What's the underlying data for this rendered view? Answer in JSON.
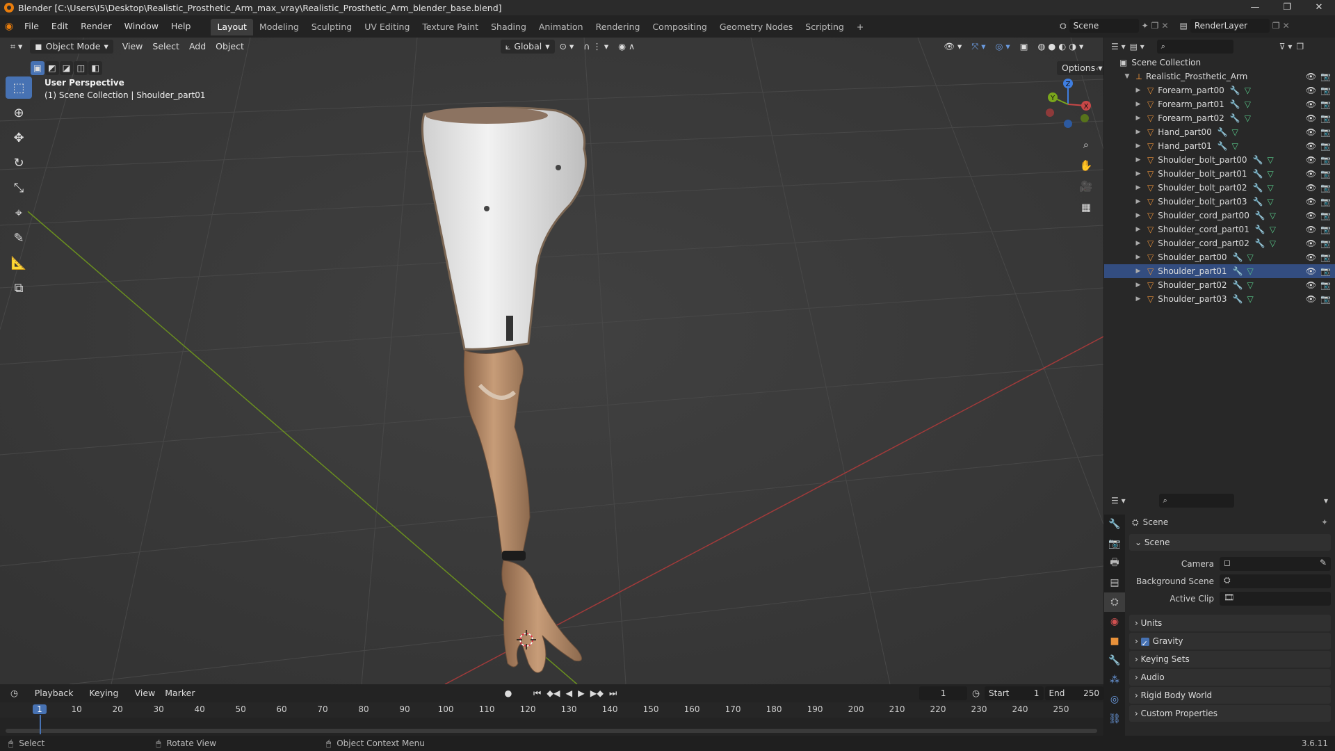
{
  "window": {
    "title": "Blender [C:\\Users\\I5\\Desktop\\Realistic_Prosthetic_Arm_max_vray\\Realistic_Prosthetic_Arm_blender_base.blend]",
    "controls": [
      "—",
      "❐",
      "✕"
    ]
  },
  "menubar": {
    "menus": [
      "File",
      "Edit",
      "Render",
      "Window",
      "Help"
    ],
    "workspaces": [
      "Layout",
      "Modeling",
      "Sculpting",
      "UV Editing",
      "Texture Paint",
      "Shading",
      "Animation",
      "Rendering",
      "Compositing",
      "Geometry Nodes",
      "Scripting"
    ],
    "add_tab": "+",
    "scene": "Scene",
    "view_layer": "RenderLayer"
  },
  "viewport": {
    "mode": "Object Mode",
    "menus": [
      "View",
      "Select",
      "Add",
      "Object"
    ],
    "orientation": "Global",
    "options_label": "Options",
    "overlay_line1": "User Perspective",
    "overlay_line2": "(1) Scene Collection | Shoulder_part01",
    "gizmo_axes": {
      "x": "X",
      "y": "Y",
      "z": "Z"
    }
  },
  "outliner": {
    "root": "Scene Collection",
    "collection": "Realistic_Prosthetic_Arm",
    "objects": [
      {
        "name": "Forearm_part00"
      },
      {
        "name": "Forearm_part01"
      },
      {
        "name": "Forearm_part02"
      },
      {
        "name": "Hand_part00"
      },
      {
        "name": "Hand_part01"
      },
      {
        "name": "Shoulder_bolt_part00"
      },
      {
        "name": "Shoulder_bolt_part01"
      },
      {
        "name": "Shoulder_bolt_part02"
      },
      {
        "name": "Shoulder_bolt_part03"
      },
      {
        "name": "Shoulder_cord_part00"
      },
      {
        "name": "Shoulder_cord_part01"
      },
      {
        "name": "Shoulder_cord_part02"
      },
      {
        "name": "Shoulder_part00"
      },
      {
        "name": "Shoulder_part01"
      },
      {
        "name": "Shoulder_part02"
      },
      {
        "name": "Shoulder_part03"
      }
    ],
    "selected_index": 13
  },
  "properties": {
    "context_title": "Scene",
    "scene_panel": "Scene",
    "fields": [
      {
        "label": "Camera"
      },
      {
        "label": "Background Scene"
      },
      {
        "label": "Active Clip"
      }
    ],
    "panels": [
      "Units",
      "Gravity",
      "Keying Sets",
      "Audio",
      "Rigid Body World",
      "Custom Properties"
    ],
    "gravity_checked": true
  },
  "timeline": {
    "menus": [
      "Playback",
      "Keying",
      "View",
      "Marker"
    ],
    "current_frame": "1",
    "start_label": "Start",
    "start": "1",
    "end_label": "End",
    "end": "250",
    "ticks": [
      "1",
      "10",
      "20",
      "30",
      "40",
      "50",
      "60",
      "70",
      "80",
      "90",
      "100",
      "110",
      "120",
      "130",
      "140",
      "150",
      "160",
      "170",
      "180",
      "190",
      "200",
      "210",
      "220",
      "230",
      "240",
      "250"
    ]
  },
  "statusbar": {
    "items": [
      "Select",
      "Rotate View",
      "Object Context Menu"
    ],
    "version": "3.6.11"
  },
  "colors": {
    "accent": "#4772b3",
    "viewport_bg": "#3b3b3b",
    "panel_bg": "#282828",
    "object_orange": "#e8913a",
    "x_axis": "#c84747",
    "y_axis": "#7aa61c",
    "z_axis": "#3f7ee0"
  }
}
